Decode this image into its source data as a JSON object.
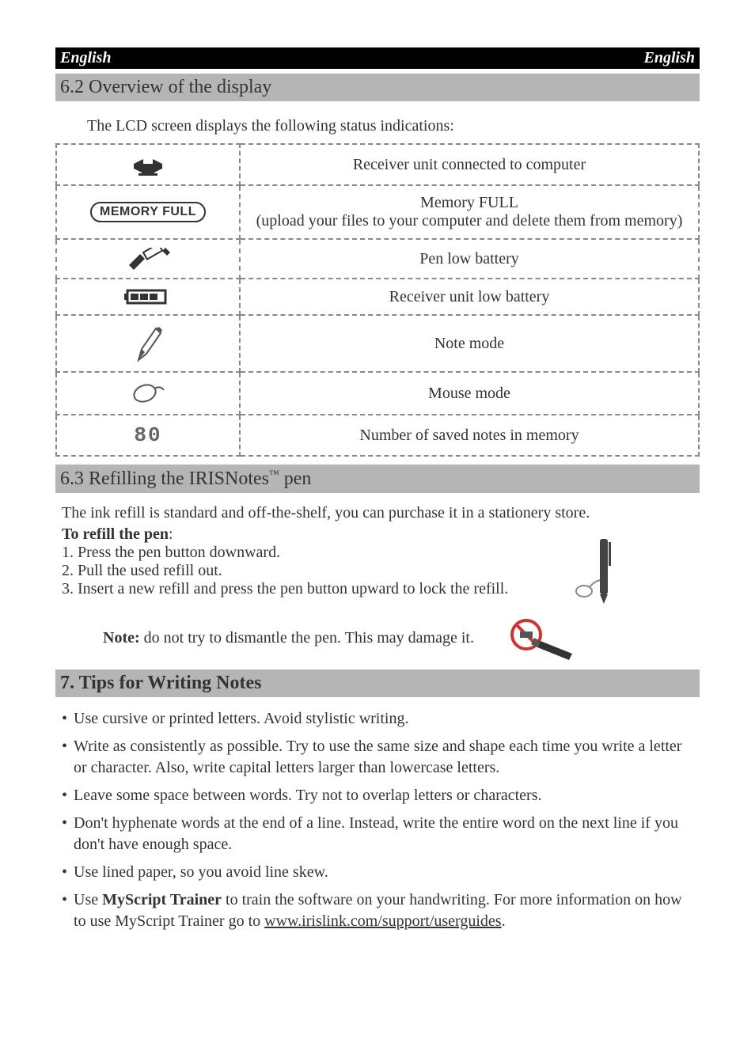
{
  "lang": {
    "left": "English",
    "right": "English"
  },
  "section62": {
    "heading": "6.2 Overview of the display",
    "intro": "The LCD screen displays the following status indications:",
    "rows": {
      "receiver": "Receiver unit connected to computer",
      "memfull_badge": "MEMORY FULL",
      "memfull_line1": "Memory FULL",
      "memfull_line2": "(upload your files to your computer and delete them from memory)",
      "penlow": "Pen low battery",
      "recvlow": "Receiver unit low battery",
      "notemode": "Note mode",
      "mousemode": "Mouse mode",
      "count_icon": "80",
      "count": "Number of saved notes in memory"
    }
  },
  "section63": {
    "heading_pre": "6.3 Refilling the IRISNotes",
    "heading_tm": "™",
    "heading_post": " pen",
    "para": "The ink refill is standard and off-the-shelf, you can purchase it in a stationery store.",
    "label": "To refill the pen",
    "colon": ":",
    "step1": "1. Press the pen button downward.",
    "step2": "2. Pull the used refill out.",
    "step3": "3. Insert a new refill and press the pen button upward to lock the refill.",
    "note_label": "Note:",
    "note_text": " do not try to dismantle the pen. This may damage it."
  },
  "section7": {
    "heading": "7. Tips for Writing Notes",
    "tips": [
      "Use cursive or printed letters. Avoid stylistic writing.",
      "Write as consistently as possible. Try to use the same size and shape each time you write a letter or character. Also, write capital letters larger than lowercase letters.",
      "Leave some space between words. Try not to overlap letters or characters.",
      "Don't hyphenate words at the end of a line. Instead, write the entire word on the next line if you don't have enough space.",
      "Use lined paper, so you avoid line skew."
    ],
    "tip6_pre": "Use ",
    "tip6_bold": "MyScript Trainer",
    "tip6_mid": " to train the software on your handwriting. For more information on how to use MyScript Trainer go to ",
    "tip6_link": "www.irislink.com/support/userguides",
    "tip6_post": "."
  }
}
